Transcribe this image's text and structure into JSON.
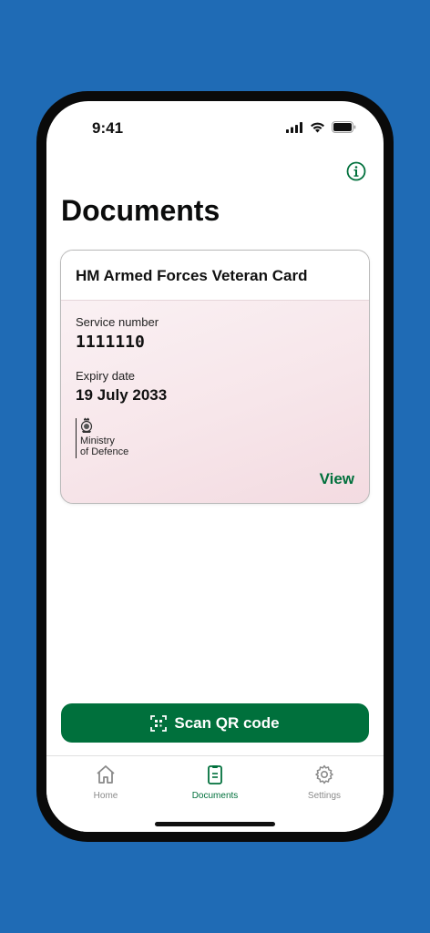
{
  "status_bar": {
    "time": "9:41"
  },
  "page": {
    "title": "Documents"
  },
  "card": {
    "title": "HM Armed Forces Veteran Card",
    "service_number_label": "Service number",
    "service_number": "1111110",
    "expiry_label": "Expiry date",
    "expiry_value": "19 July 2033",
    "issuer_line1": "Ministry",
    "issuer_line2": "of Defence",
    "view_label": "View"
  },
  "actions": {
    "scan_label": "Scan QR code"
  },
  "tab_bar": {
    "items": [
      {
        "label": "Home",
        "icon": "home-icon",
        "active": false
      },
      {
        "label": "Documents",
        "icon": "document-icon",
        "active": true
      },
      {
        "label": "Settings",
        "icon": "gear-icon",
        "active": false
      }
    ]
  },
  "colors": {
    "accent_green": "#00703c",
    "background_blue": "#1f6bb5",
    "card_tint": "#f7e6ea",
    "inactive_tab": "#8a8a8a"
  }
}
